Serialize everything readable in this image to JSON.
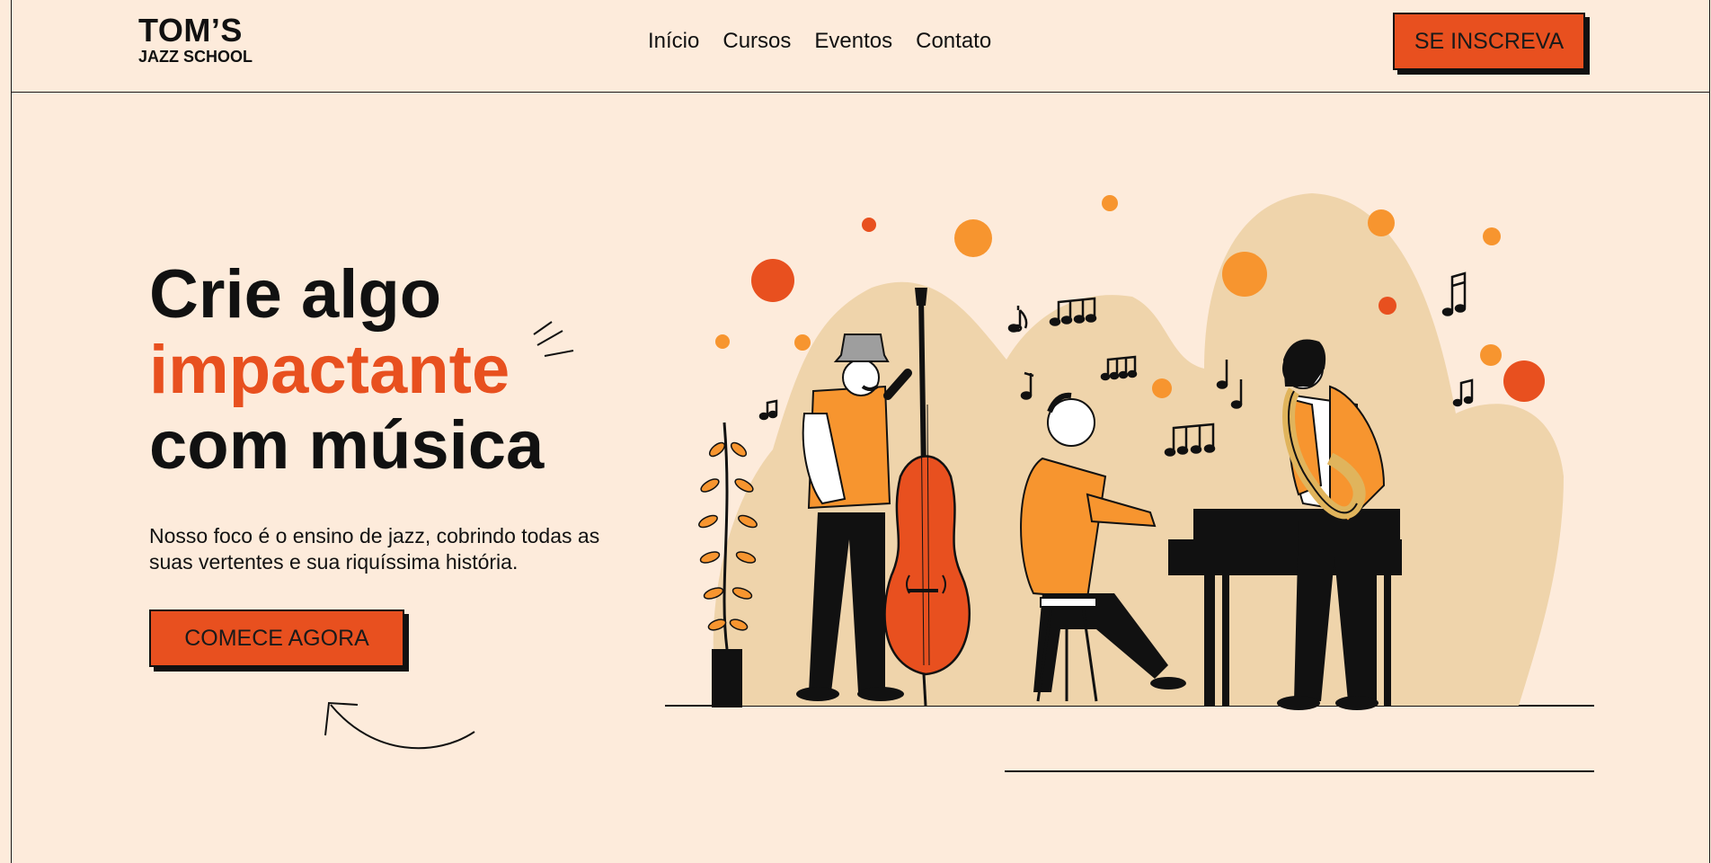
{
  "brand": {
    "line1": "TOM’S",
    "line2": "JAZZ SCHOOL"
  },
  "nav": {
    "items": [
      "Início",
      "Cursos",
      "Eventos",
      "Contato"
    ]
  },
  "header": {
    "signup_label": "SE INSCREVA"
  },
  "hero": {
    "title_line1": "Crie algo",
    "title_line2": "impactante",
    "title_line3": "com música",
    "description": "Nosso foco é o ensino de jazz, cobrindo todas as suas vertentes e sua riquíssima história.",
    "cta_label": "COMECE AGORA"
  },
  "colors": {
    "accent": "#e8501f",
    "orange": "#f7952f",
    "background": "#fdebdb",
    "blob": "#efd4ab",
    "ink": "#111111"
  },
  "illustration": {
    "icon": "jazz-band-illustration"
  }
}
